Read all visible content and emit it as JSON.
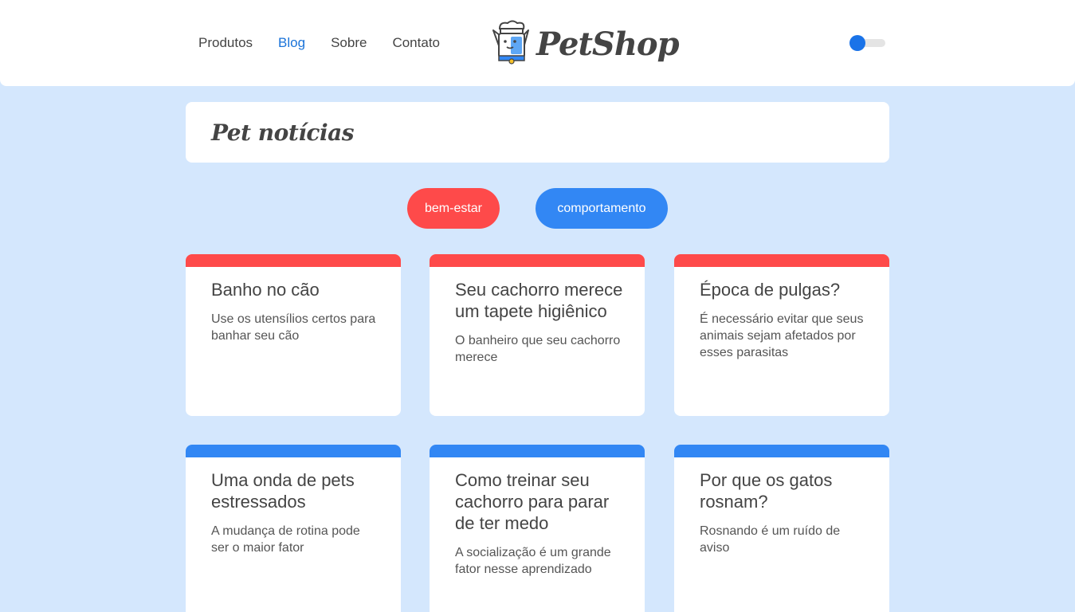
{
  "nav": {
    "items": [
      {
        "label": "Produtos",
        "active": false
      },
      {
        "label": "Blog",
        "active": true
      },
      {
        "label": "Sobre",
        "active": false
      },
      {
        "label": "Contato",
        "active": false
      }
    ]
  },
  "logo": {
    "text": "PetShop",
    "icon": "dog-chef-icon"
  },
  "theme_toggle": {
    "state": "off"
  },
  "page": {
    "title": "Pet notícias"
  },
  "categories": [
    {
      "label": "bem-estar",
      "color": "#fe4a4a"
    },
    {
      "label": "comportamento",
      "color": "#3287f4"
    }
  ],
  "posts": [
    {
      "title": "Banho no cão",
      "summary": "Use os utensílios certos para banhar seu cão",
      "category": "bem-estar"
    },
    {
      "title": "Seu cachorro merece um tapete higiênico",
      "summary": "O banheiro que seu cachorro merece",
      "category": "bem-estar"
    },
    {
      "title": "Época de pulgas?",
      "summary": "É necessário evitar que seus animais sejam afetados por esses parasitas",
      "category": "bem-estar"
    },
    {
      "title": "Uma onda de pets estressados",
      "summary": "A mudança de rotina pode ser o maior fator",
      "category": "comportamento"
    },
    {
      "title": "Como treinar seu cachorro para parar de ter medo",
      "summary": "A socialização é um grande fator nesse aprendizado",
      "category": "comportamento"
    },
    {
      "title": "Por que os gatos rosnam?",
      "summary": "Rosnando é um ruído de aviso",
      "category": "comportamento"
    }
  ],
  "colors": {
    "accent": "#1a73e8",
    "background": "#d4e7fd",
    "red": "#fe4a4a",
    "blue": "#3287f4"
  }
}
